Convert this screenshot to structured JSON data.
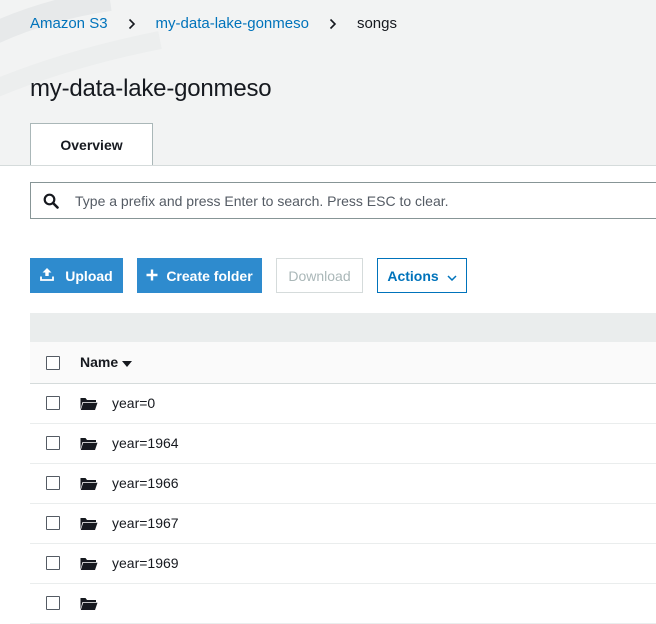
{
  "breadcrumb": {
    "root": "Amazon S3",
    "bucket": "my-data-lake-gonmeso",
    "current": "songs"
  },
  "page": {
    "title": "my-data-lake-gonmeso"
  },
  "tabs": [
    {
      "label": "Overview",
      "active": true
    }
  ],
  "search": {
    "placeholder": "Type a prefix and press Enter to search. Press ESC to clear.",
    "value": ""
  },
  "toolbar": {
    "upload_label": "Upload",
    "create_folder_label": "Create folder",
    "download_label": "Download",
    "actions_label": "Actions"
  },
  "table": {
    "columns": [
      {
        "label": "Name",
        "sort": "descending"
      }
    ],
    "rows": [
      {
        "name": "year=0",
        "type": "folder"
      },
      {
        "name": "year=1964",
        "type": "folder"
      },
      {
        "name": "year=1966",
        "type": "folder"
      },
      {
        "name": "year=1967",
        "type": "folder"
      },
      {
        "name": "year=1969",
        "type": "folder"
      },
      {
        "name": "",
        "type": "folder"
      }
    ]
  },
  "icons": {
    "search": "search-icon",
    "upload": "upload-icon",
    "create_folder": "plus-icon",
    "actions_dropdown": "chevron-down-icon",
    "sort": "sort-down-icon",
    "folder": "folder-open-icon"
  },
  "colors": {
    "link": "#0073bb",
    "primary_button": "#2e8bce",
    "header_background": "#f2f3f3",
    "text": "#16191f",
    "disabled_text": "#aab7b8"
  }
}
